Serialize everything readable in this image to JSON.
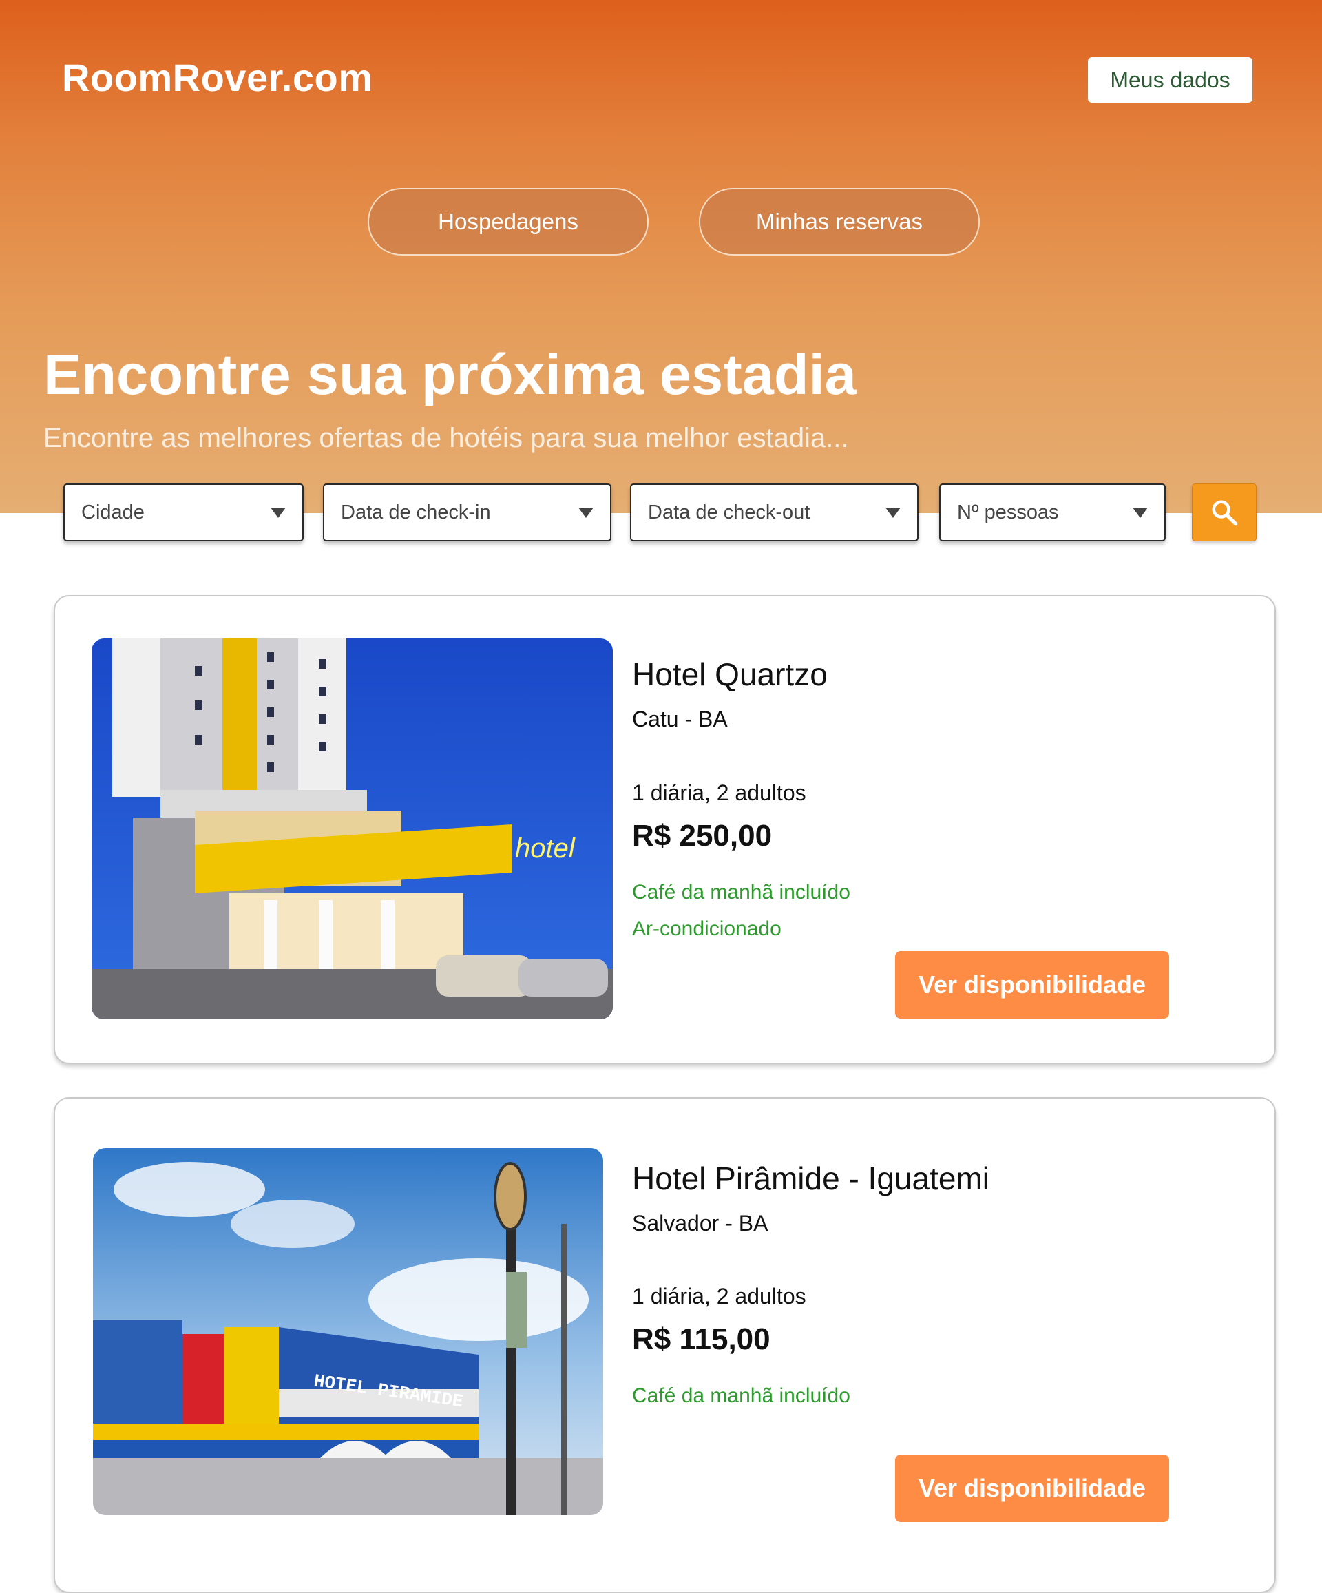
{
  "header": {
    "logo": "RoomRover.com",
    "account_button": "Meus dados",
    "nav": [
      {
        "label": "Hospedagens"
      },
      {
        "label": "Minhas reservas"
      }
    ]
  },
  "hero": {
    "title": "Encontre sua próxima estadia",
    "subtitle": "Encontre as melhores ofertas de hotéis para sua melhor estadia..."
  },
  "search": {
    "filters": [
      {
        "label": "Cidade"
      },
      {
        "label": "Data de check-in"
      },
      {
        "label": "Data de check-out"
      },
      {
        "label": "Nº pessoas"
      }
    ],
    "button_icon": "search-icon"
  },
  "results": [
    {
      "name": "Hotel Quartzo",
      "location": "Catu - BA",
      "stay": "1 diária, 2 adultos",
      "price": "R$ 250,00",
      "amenities": [
        "Café da manhã incluído",
        "Ar-condicionado"
      ],
      "photo_sign": "hotel",
      "button": "Ver disponibilidade"
    },
    {
      "name": "Hotel Pirâmide - Iguatemi",
      "location": "Salvador - BA",
      "stay": "1 diária, 2 adultos",
      "price": "R$ 115,00",
      "amenities": [
        "Café da manhã incluído"
      ],
      "photo_sign": "HOTEL PIRAMIDE",
      "button": "Ver disponibilidade"
    }
  ],
  "colors": {
    "hero_top": "#dd601c",
    "hero_bottom": "#e5ae72",
    "search_button": "#f59a1c",
    "availability_button": "#ff8c45",
    "amenity_text": "#2e9a2e"
  }
}
